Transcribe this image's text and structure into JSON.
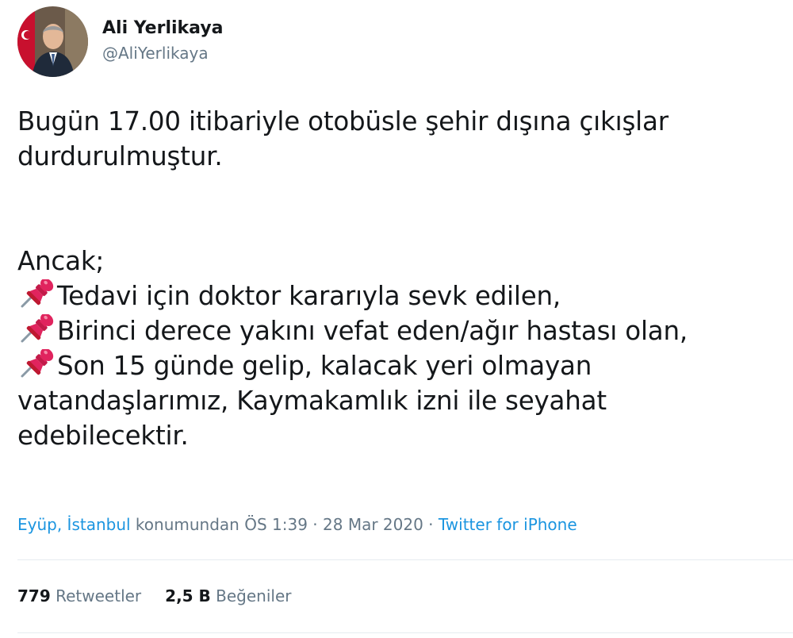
{
  "author": {
    "display_name": "Ali Yerlikaya",
    "handle": "@AliYerlikaya"
  },
  "tweet": {
    "line1": "Bugün 17.00 itibariyle otobüsle şehir dışına çıkışlar",
    "line2": "durdurulmuştur.",
    "line3": "Ancak;",
    "bullet1": "Tedavi için doktor kararıyla sevk edilen,",
    "bullet2": "Birinci derece yakını vefat eden/ağır hastası olan,",
    "bullet3": "Son 15 günde gelip, kalacak yeri olmayan",
    "line7": "vatandaşlarımız, Kaymakamlık izni ile seyahat",
    "line8": "edebilecektir.",
    "bullet_icon": "pushpin-icon"
  },
  "meta": {
    "location": "Eyüp, İstanbul",
    "location_suffix": " konumundan ",
    "time": "ÖS 1:39",
    "separator": " · ",
    "date": "28 Mar 2020",
    "separator2": " · ",
    "source": "Twitter for iPhone"
  },
  "stats": {
    "retweets_count": "779",
    "retweets_label": "Retweetler",
    "likes_count": "2,5 B",
    "likes_label": "Beğeniler"
  },
  "colors": {
    "text": "#14171a",
    "secondary": "#657786",
    "link": "#1b95e0",
    "divider": "#e6ecf0",
    "pin": "#e0245e"
  }
}
